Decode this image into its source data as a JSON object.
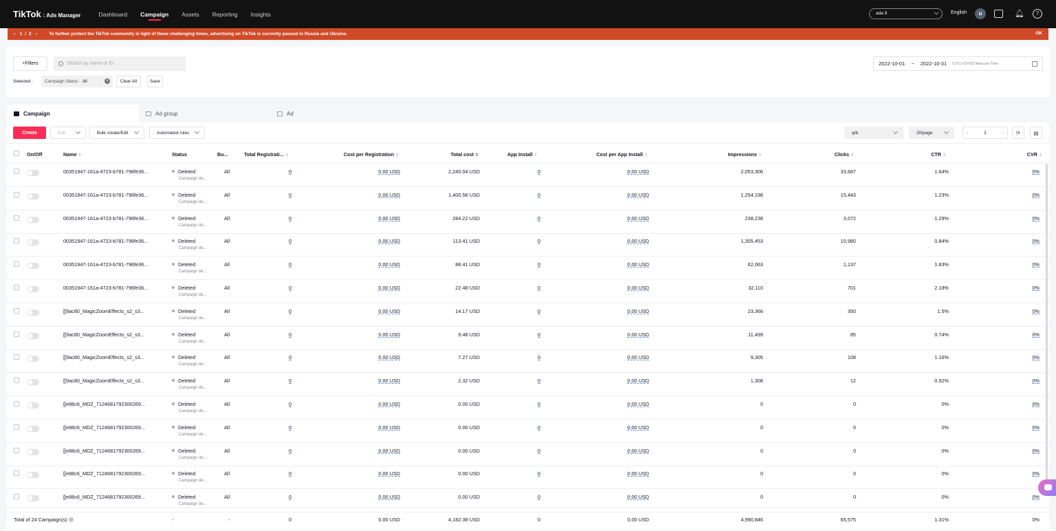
{
  "nav": {
    "brand": "TikTok",
    "brand_sub": ": Ads Manager",
    "links": [
      "Dashboard",
      "Campaign",
      "Assets",
      "Reporting",
      "Insights"
    ],
    "active": "Campaign",
    "account": "ada 9",
    "language": "English",
    "avatar_letter": "u"
  },
  "banner": {
    "pager": "1 / 2",
    "message": "To further protect the TikTok community in light of these challenging times, advertising on TikTok is currently paused in Russia and Ukraine.",
    "ok": "OK"
  },
  "filters": {
    "filters_label": "+Filters",
    "search_placeholder": "Search by name or ID",
    "selected_label": "Selected :",
    "chip_key": "Campaign Status :",
    "chip_value": "All",
    "clear_all": "Clear All",
    "save": "Save",
    "date_start": "2022-10-01",
    "date_sep": "~",
    "date_end": "2022-10-31",
    "timezone": "(UTC+03:00) Moscow Time"
  },
  "tabs": [
    "Campaign",
    "Ad group",
    "Ad"
  ],
  "toolbar": {
    "create": "Create",
    "edit": "Edit",
    "bulk": "Bulk create/Edit",
    "automated": "Automated rules",
    "column_preset": "qrb",
    "page_size": "20/page",
    "page": "1"
  },
  "table": {
    "headers": [
      "On/Off",
      "Name",
      "Status",
      "Bu...",
      "Total Registrati...",
      "Cost per Registration",
      "Total cost",
      "App Install",
      "Cost per App Install",
      "Impressions",
      "Clicks",
      "CTR",
      "CVR"
    ],
    "rows": [
      {
        "name": "00351947-161a-4723-b781-796fe36...",
        "status": "Deleted",
        "sub": "Campaign de...",
        "budget": "All",
        "reg": "0",
        "cpr": "0.00 USD",
        "cost": "2,240.04 USD",
        "install": "0",
        "cpi": "0.00 USD",
        "impr": "2,053,306",
        "clicks": "33,687",
        "ctr": "1.64%",
        "cvr": "0%"
      },
      {
        "name": "00351947-161a-4723-b781-796fe36...",
        "status": "Deleted",
        "sub": "Campaign de...",
        "budget": "All",
        "reg": "0",
        "cpr": "0.00 USD",
        "cost": "1,400.58 USD",
        "install": "0",
        "cpi": "0.00 USD",
        "impr": "1,254,198",
        "clicks": "15,443",
        "ctr": "1.23%",
        "cvr": "0%"
      },
      {
        "name": "00351947-161a-4723-b781-796fe36...",
        "status": "Deleted",
        "sub": "Campaign de...",
        "budget": "All",
        "reg": "0",
        "cpr": "0.00 USD",
        "cost": "284.22 USD",
        "install": "0",
        "cpi": "0.00 USD",
        "impr": "238,238",
        "clicks": "3,072",
        "ctr": "1.29%",
        "cvr": "0%"
      },
      {
        "name": "00351947-161a-4723-b781-796fe36...",
        "status": "Deleted",
        "sub": "Campaign de...",
        "budget": "All",
        "reg": "0",
        "cpr": "0.00 USD",
        "cost": "113.41 USD",
        "install": "0",
        "cpi": "0.00 USD",
        "impr": "1,305,453",
        "clicks": "10,980",
        "ctr": "0.84%",
        "cvr": "0%"
      },
      {
        "name": "00351947-161a-4723-b781-796fe36...",
        "status": "Deleted",
        "sub": "Campaign de...",
        "budget": "All",
        "reg": "0",
        "cpr": "0.00 USD",
        "cost": "88.41 USD",
        "install": "0",
        "cpi": "0.00 USD",
        "impr": "62,063",
        "clicks": "1,137",
        "ctr": "1.83%",
        "cvr": "0%"
      },
      {
        "name": "00351947-161a-4723-b781-796fe36...",
        "status": "Deleted",
        "sub": "Campaign de...",
        "budget": "All",
        "reg": "0",
        "cpr": "0.00 USD",
        "cost": "22.48 USD",
        "install": "0",
        "cpi": "0.00 USD",
        "impr": "32,110",
        "clicks": "701",
        "ctr": "2.18%",
        "cvr": "0%"
      },
      {
        "name": "[[9ac80_MagicZoomEffects_s2_s3...",
        "status": "Deleted",
        "sub": "Campaign de...",
        "budget": "All",
        "reg": "0",
        "cpr": "0.00 USD",
        "cost": "14.17 USD",
        "install": "0",
        "cpi": "0.00 USD",
        "impr": "23,366",
        "clicks": "350",
        "ctr": "1.5%",
        "cvr": "0%"
      },
      {
        "name": "[[9ac80_MagicZoomEffects_s2_s3...",
        "status": "Deleted",
        "sub": "Campaign de...",
        "budget": "All",
        "reg": "0",
        "cpr": "0.00 USD",
        "cost": "9.48 USD",
        "install": "0",
        "cpi": "0.00 USD",
        "impr": "11,499",
        "clicks": "85",
        "ctr": "0.74%",
        "cvr": "0%"
      },
      {
        "name": "[[9ac80_MagicZoomEffects_s2_s3...",
        "status": "Deleted",
        "sub": "Campaign de...",
        "budget": "All",
        "reg": "0",
        "cpr": "0.00 USD",
        "cost": "7.27 USD",
        "install": "0",
        "cpi": "0.00 USD",
        "impr": "9,305",
        "clicks": "108",
        "ctr": "1.16%",
        "cvr": "0%"
      },
      {
        "name": "[[9ac80_MagicZoomEffects_s2_s3...",
        "status": "Deleted",
        "sub": "Campaign de...",
        "budget": "All",
        "reg": "0",
        "cpr": "0.00 USD",
        "cost": "2.32 USD",
        "install": "0",
        "cpi": "0.00 USD",
        "impr": "1,308",
        "clicks": "12",
        "ctr": "0.92%",
        "cvr": "0%"
      },
      {
        "name": "[[e88c6_MDZ_7124681792300269...",
        "status": "Deleted",
        "sub": "Campaign de...",
        "budget": "All",
        "reg": "0",
        "cpr": "0.00 USD",
        "cost": "0.00 USD",
        "install": "0",
        "cpi": "0.00 USD",
        "impr": "0",
        "clicks": "0",
        "ctr": "0%",
        "cvr": "0%"
      },
      {
        "name": "[[e88c6_MDZ_7124681792300269...",
        "status": "Deleted",
        "sub": "Campaign de...",
        "budget": "All",
        "reg": "0",
        "cpr": "0.00 USD",
        "cost": "0.00 USD",
        "install": "0",
        "cpi": "0.00 USD",
        "impr": "0",
        "clicks": "0",
        "ctr": "0%",
        "cvr": "0%"
      },
      {
        "name": "[[e88c6_MDZ_7124681792300269...",
        "status": "Deleted",
        "sub": "Campaign de...",
        "budget": "All",
        "reg": "0",
        "cpr": "0.00 USD",
        "cost": "0.00 USD",
        "install": "0",
        "cpi": "0.00 USD",
        "impr": "0",
        "clicks": "0",
        "ctr": "0%",
        "cvr": "0%"
      },
      {
        "name": "[[e88c6_MDZ_7124681792300269...",
        "status": "Deleted",
        "sub": "Campaign de...",
        "budget": "All",
        "reg": "0",
        "cpr": "0.00 USD",
        "cost": "0.00 USD",
        "install": "0",
        "cpi": "0.00 USD",
        "impr": "0",
        "clicks": "0",
        "ctr": "0%",
        "cvr": "0%"
      },
      {
        "name": "[[e88c6_MDZ_7124681792300269...",
        "status": "Deleted",
        "sub": "Campaign de...",
        "budget": "All",
        "reg": "0",
        "cpr": "0.00 USD",
        "cost": "0.00 USD",
        "install": "0",
        "cpi": "0.00 USD",
        "impr": "0",
        "clicks": "0",
        "ctr": "0%",
        "cvr": "0%"
      }
    ],
    "footer": {
      "total_label": "Total of 24 Campaign(s)",
      "status": "-",
      "budget": "-",
      "reg": "0",
      "cpr": "0.00 USD",
      "cost": "4,182.38 USD",
      "install": "0",
      "cpi": "0.00 USD",
      "impr": "4,990,846",
      "clicks": "65,575",
      "ctr": "1.31%",
      "cvr": "0%"
    }
  },
  "colors": {
    "accent": "#fe2c55",
    "banner": "#d04a28",
    "nav_bg": "#121212"
  },
  "icons": [
    "search-icon",
    "calendar-icon",
    "close-icon",
    "folder-icon",
    "refresh-icon",
    "export-icon",
    "bell-icon",
    "help-icon",
    "inbox-icon",
    "chat-icon",
    "info-icon"
  ]
}
